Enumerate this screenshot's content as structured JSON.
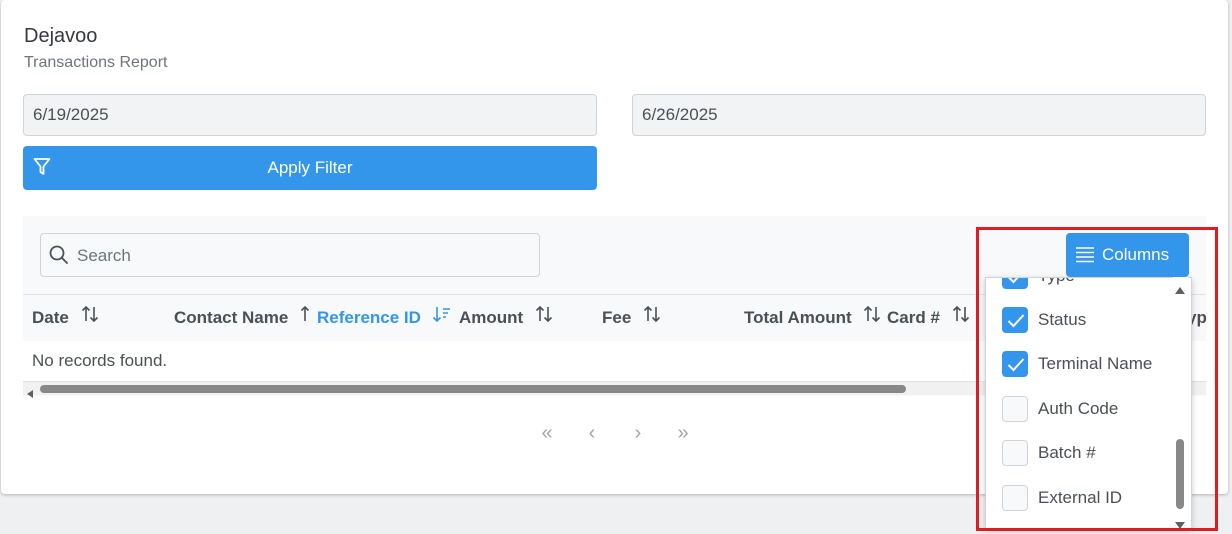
{
  "app": {
    "title": "Dejavoo",
    "subtitle": "Transactions Report"
  },
  "filters": {
    "date_from": "6/19/2025",
    "date_to": "6/26/2025",
    "apply_label": "Apply Filter"
  },
  "table": {
    "search_placeholder": "Search",
    "columns_button_label": "Columns",
    "headers": [
      {
        "label": "Date",
        "sort": "unsorted"
      },
      {
        "label": "Contact Name",
        "sort": "asc"
      },
      {
        "label": "Reference ID",
        "sort": "desc",
        "active": true
      },
      {
        "label": "Amount",
        "sort": "unsorted"
      },
      {
        "label": "Fee",
        "sort": "unsorted"
      },
      {
        "label": "Total Amount",
        "sort": "unsorted"
      },
      {
        "label": "Card #",
        "sort": "unsorted"
      }
    ],
    "clipped_header": "ype",
    "empty_message": "No records found."
  },
  "column_chooser": {
    "items": [
      {
        "label": "Type",
        "checked": true
      },
      {
        "label": "Status",
        "checked": true
      },
      {
        "label": "Terminal Name",
        "checked": true
      },
      {
        "label": "Auth Code",
        "checked": false
      },
      {
        "label": "Batch #",
        "checked": false
      },
      {
        "label": "External ID",
        "checked": false
      }
    ]
  },
  "pagination": {
    "first": "«",
    "prev": "‹",
    "next": "›",
    "last": "»"
  },
  "colors": {
    "primary": "#3396ea",
    "highlight": "#e11b22"
  }
}
